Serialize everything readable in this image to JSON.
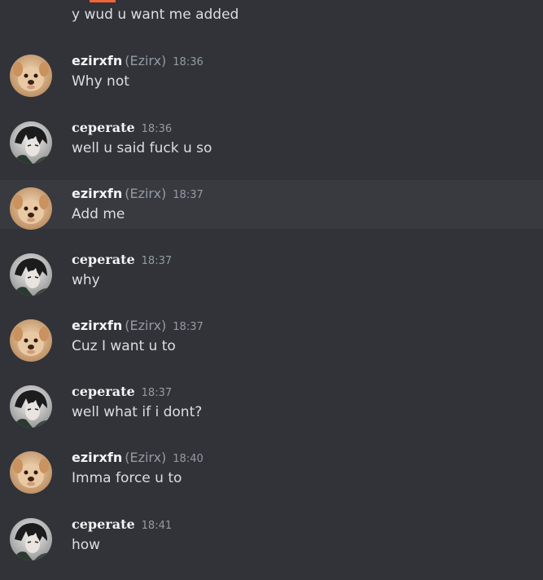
{
  "previous_message": "y wud u want me added",
  "messages": [
    {
      "username": "ezirxfn",
      "nickname": "(Ezirx)",
      "time": "18:36",
      "text": "Why not"
    },
    {
      "username": "ceperate",
      "nickname": "",
      "time": "18:36",
      "text": "well u said fuck u so"
    },
    {
      "username": "ezirxfn",
      "nickname": "(Ezirx)",
      "time": "18:37",
      "text": "Add me"
    },
    {
      "username": "ceperate",
      "nickname": "",
      "time": "18:37",
      "text": "why"
    },
    {
      "username": "ezirxfn",
      "nickname": "(Ezirx)",
      "time": "18:37",
      "text": "Cuz I want u to"
    },
    {
      "username": "ceperate",
      "nickname": "",
      "time": "18:37",
      "text": "well what if i dont?"
    },
    {
      "username": "ezirxfn",
      "nickname": "(Ezirx)",
      "time": "18:40",
      "text": "Imma force u to"
    },
    {
      "username": "ceperate",
      "nickname": "",
      "time": "18:41",
      "text": "how"
    }
  ],
  "colors": {
    "background": "#313338",
    "hover_row": "#393a40",
    "text": "#dbdee1",
    "muted": "#949ba4",
    "accent": "#f0643a"
  }
}
